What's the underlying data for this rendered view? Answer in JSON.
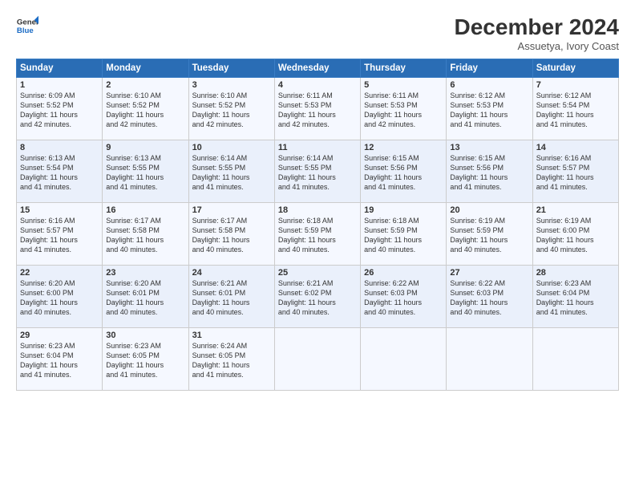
{
  "header": {
    "logo_line1": "General",
    "logo_line2": "Blue",
    "main_title": "December 2024",
    "subtitle": "Assuetya, Ivory Coast"
  },
  "days_of_week": [
    "Sunday",
    "Monday",
    "Tuesday",
    "Wednesday",
    "Thursday",
    "Friday",
    "Saturday"
  ],
  "weeks": [
    [
      {
        "day": "1",
        "info": "Sunrise: 6:09 AM\nSunset: 5:52 PM\nDaylight: 11 hours\nand 42 minutes."
      },
      {
        "day": "2",
        "info": "Sunrise: 6:10 AM\nSunset: 5:52 PM\nDaylight: 11 hours\nand 42 minutes."
      },
      {
        "day": "3",
        "info": "Sunrise: 6:10 AM\nSunset: 5:52 PM\nDaylight: 11 hours\nand 42 minutes."
      },
      {
        "day": "4",
        "info": "Sunrise: 6:11 AM\nSunset: 5:53 PM\nDaylight: 11 hours\nand 42 minutes."
      },
      {
        "day": "5",
        "info": "Sunrise: 6:11 AM\nSunset: 5:53 PM\nDaylight: 11 hours\nand 42 minutes."
      },
      {
        "day": "6",
        "info": "Sunrise: 6:12 AM\nSunset: 5:53 PM\nDaylight: 11 hours\nand 41 minutes."
      },
      {
        "day": "7",
        "info": "Sunrise: 6:12 AM\nSunset: 5:54 PM\nDaylight: 11 hours\nand 41 minutes."
      }
    ],
    [
      {
        "day": "8",
        "info": "Sunrise: 6:13 AM\nSunset: 5:54 PM\nDaylight: 11 hours\nand 41 minutes."
      },
      {
        "day": "9",
        "info": "Sunrise: 6:13 AM\nSunset: 5:55 PM\nDaylight: 11 hours\nand 41 minutes."
      },
      {
        "day": "10",
        "info": "Sunrise: 6:14 AM\nSunset: 5:55 PM\nDaylight: 11 hours\nand 41 minutes."
      },
      {
        "day": "11",
        "info": "Sunrise: 6:14 AM\nSunset: 5:55 PM\nDaylight: 11 hours\nand 41 minutes."
      },
      {
        "day": "12",
        "info": "Sunrise: 6:15 AM\nSunset: 5:56 PM\nDaylight: 11 hours\nand 41 minutes."
      },
      {
        "day": "13",
        "info": "Sunrise: 6:15 AM\nSunset: 5:56 PM\nDaylight: 11 hours\nand 41 minutes."
      },
      {
        "day": "14",
        "info": "Sunrise: 6:16 AM\nSunset: 5:57 PM\nDaylight: 11 hours\nand 41 minutes."
      }
    ],
    [
      {
        "day": "15",
        "info": "Sunrise: 6:16 AM\nSunset: 5:57 PM\nDaylight: 11 hours\nand 41 minutes."
      },
      {
        "day": "16",
        "info": "Sunrise: 6:17 AM\nSunset: 5:58 PM\nDaylight: 11 hours\nand 40 minutes."
      },
      {
        "day": "17",
        "info": "Sunrise: 6:17 AM\nSunset: 5:58 PM\nDaylight: 11 hours\nand 40 minutes."
      },
      {
        "day": "18",
        "info": "Sunrise: 6:18 AM\nSunset: 5:59 PM\nDaylight: 11 hours\nand 40 minutes."
      },
      {
        "day": "19",
        "info": "Sunrise: 6:18 AM\nSunset: 5:59 PM\nDaylight: 11 hours\nand 40 minutes."
      },
      {
        "day": "20",
        "info": "Sunrise: 6:19 AM\nSunset: 5:59 PM\nDaylight: 11 hours\nand 40 minutes."
      },
      {
        "day": "21",
        "info": "Sunrise: 6:19 AM\nSunset: 6:00 PM\nDaylight: 11 hours\nand 40 minutes."
      }
    ],
    [
      {
        "day": "22",
        "info": "Sunrise: 6:20 AM\nSunset: 6:00 PM\nDaylight: 11 hours\nand 40 minutes."
      },
      {
        "day": "23",
        "info": "Sunrise: 6:20 AM\nSunset: 6:01 PM\nDaylight: 11 hours\nand 40 minutes."
      },
      {
        "day": "24",
        "info": "Sunrise: 6:21 AM\nSunset: 6:01 PM\nDaylight: 11 hours\nand 40 minutes."
      },
      {
        "day": "25",
        "info": "Sunrise: 6:21 AM\nSunset: 6:02 PM\nDaylight: 11 hours\nand 40 minutes."
      },
      {
        "day": "26",
        "info": "Sunrise: 6:22 AM\nSunset: 6:03 PM\nDaylight: 11 hours\nand 40 minutes."
      },
      {
        "day": "27",
        "info": "Sunrise: 6:22 AM\nSunset: 6:03 PM\nDaylight: 11 hours\nand 40 minutes."
      },
      {
        "day": "28",
        "info": "Sunrise: 6:23 AM\nSunset: 6:04 PM\nDaylight: 11 hours\nand 41 minutes."
      }
    ],
    [
      {
        "day": "29",
        "info": "Sunrise: 6:23 AM\nSunset: 6:04 PM\nDaylight: 11 hours\nand 41 minutes."
      },
      {
        "day": "30",
        "info": "Sunrise: 6:23 AM\nSunset: 6:05 PM\nDaylight: 11 hours\nand 41 minutes."
      },
      {
        "day": "31",
        "info": "Sunrise: 6:24 AM\nSunset: 6:05 PM\nDaylight: 11 hours\nand 41 minutes."
      },
      {
        "day": "",
        "info": ""
      },
      {
        "day": "",
        "info": ""
      },
      {
        "day": "",
        "info": ""
      },
      {
        "day": "",
        "info": ""
      }
    ]
  ]
}
